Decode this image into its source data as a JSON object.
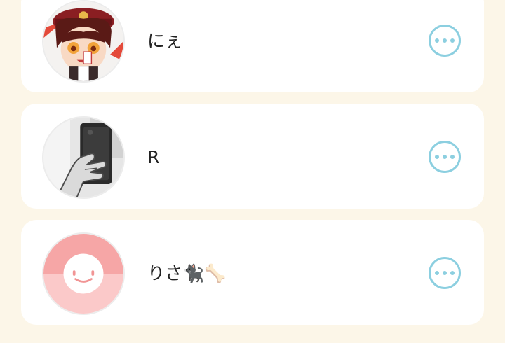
{
  "colors": {
    "page_background": "#FCF6E8",
    "card_background": "#FFFFFF",
    "menu_accent": "#8CCFE0",
    "text": "#222222"
  },
  "users": [
    {
      "name": "にぇ",
      "avatar": "anime-boy-avatar",
      "menu_icon": "more-options-icon"
    },
    {
      "name": "R",
      "avatar": "phone-selfie-avatar",
      "menu_icon": "more-options-icon"
    },
    {
      "name": "りさ🐈‍⬛🦴",
      "avatar": "pink-smiley-avatar",
      "menu_icon": "more-options-icon"
    }
  ]
}
